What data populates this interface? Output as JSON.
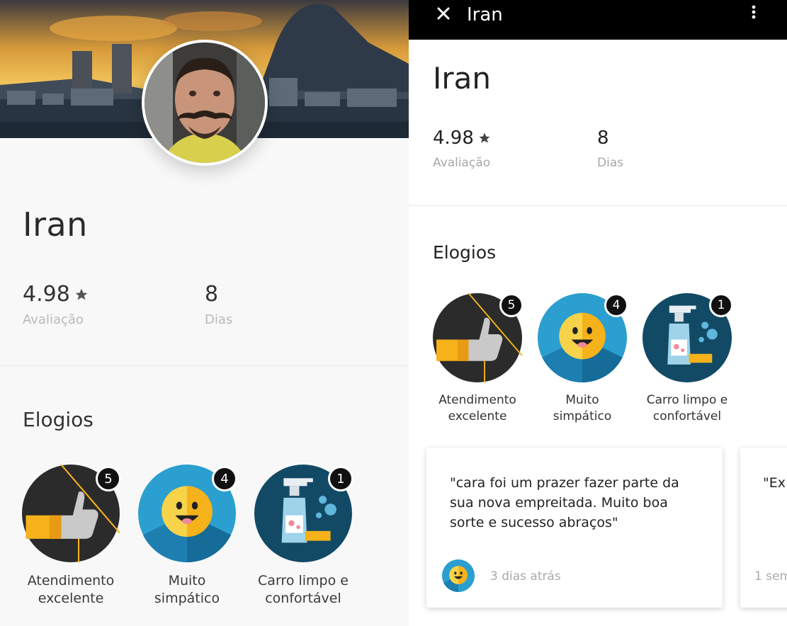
{
  "left_panel": {
    "name": "Iran",
    "rating": {
      "value": "4.98",
      "label": "Avaliação",
      "icon": "star-icon"
    },
    "days": {
      "value": "8",
      "label": "Dias"
    },
    "section_title": "Elogios",
    "compliments": [
      {
        "count": "5",
        "caption": "Atendimento\nexcelente",
        "icon": "thumbs-up-icon"
      },
      {
        "count": "4",
        "caption": "Muito\nsimpático",
        "icon": "smiley-face-icon"
      },
      {
        "count": "1",
        "caption": "Carro limpo e\nconfortável",
        "icon": "spray-bottle-icon"
      }
    ]
  },
  "right_panel": {
    "topbar": {
      "title": "Iran",
      "close_icon": "close-icon",
      "more_icon": "more-vertical-icon"
    },
    "name": "Iran",
    "rating": {
      "value": "4.98",
      "label": "Avaliação",
      "icon": "star-icon"
    },
    "days": {
      "value": "8",
      "label": "Dias"
    },
    "section_title": "Elogios",
    "compliments": [
      {
        "count": "5",
        "caption": "Atendimento\nexcelente",
        "icon": "thumbs-up-icon"
      },
      {
        "count": "4",
        "caption": "Muito\nsimpático",
        "icon": "smiley-face-icon"
      },
      {
        "count": "1",
        "caption": "Carro limpo e\nconfortável",
        "icon": "spray-bottle-icon"
      }
    ],
    "reviews": [
      {
        "quote": "\"cara foi um prazer fazer parte da\nsua nova empreitada. Muito boa\nsorte e sucesso abraços\"",
        "when": "3 dias atrás"
      },
      {
        "quote": "\"Ex",
        "when": "1 sem"
      }
    ]
  },
  "colors": {
    "badge_dark": "#2b2b2b",
    "badge_blue": "#2a9fd0",
    "badge_navy": "#124a66",
    "accent_yellow": "#f5b21b",
    "count_bg": "#111111"
  }
}
